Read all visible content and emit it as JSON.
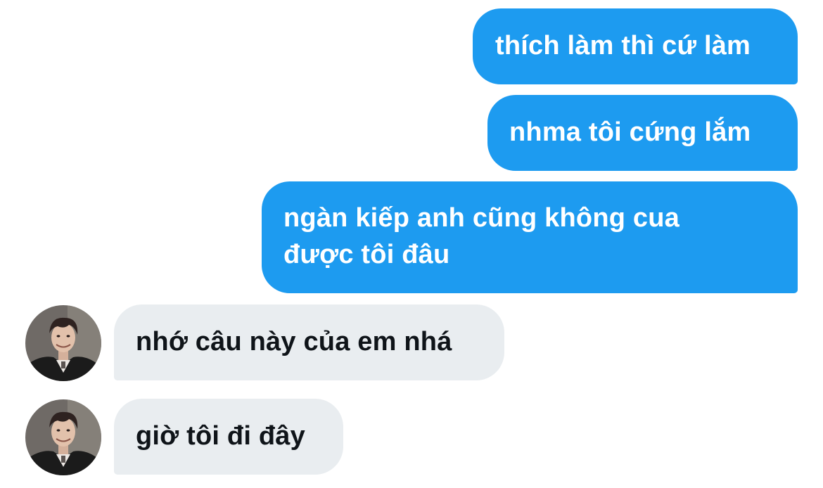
{
  "messages": [
    {
      "direction": "outgoing",
      "text": "thích làm thì cứ làm"
    },
    {
      "direction": "outgoing",
      "text": "nhma tôi cứng lắm"
    },
    {
      "direction": "outgoing",
      "lines": [
        "ngàn kiếp anh cũng không cua",
        "được tôi đâu"
      ]
    },
    {
      "direction": "incoming",
      "text": "nhớ câu này của em nhá",
      "avatar": "contact-avatar"
    },
    {
      "direction": "incoming",
      "text": "giờ tôi đi đây",
      "avatar": "contact-avatar"
    }
  ],
  "colors": {
    "outgoing_bubble": "#1d9bf0",
    "incoming_bubble": "#e9edf0",
    "incoming_text": "#0f1419",
    "outgoing_text": "#ffffff"
  }
}
